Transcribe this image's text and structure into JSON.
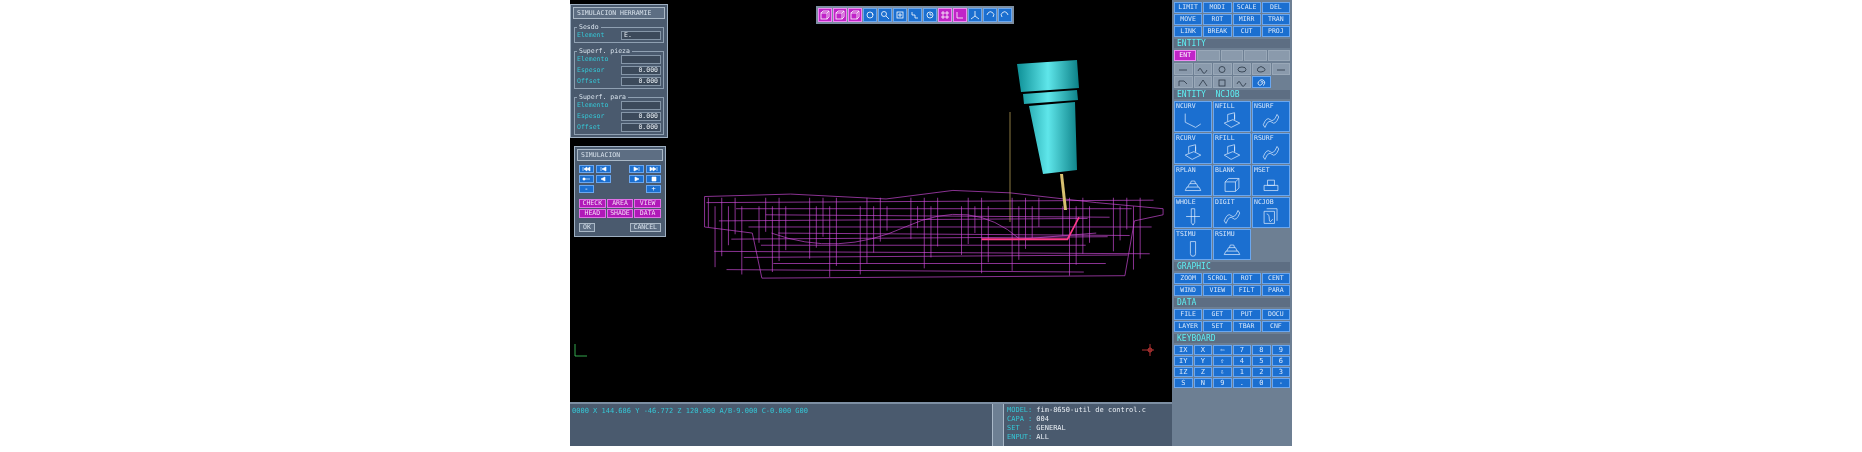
{
  "sim_dialog": {
    "title": "SIMULACION HERRAMIE",
    "groups": [
      {
        "title": "Sesdo",
        "fields": [
          {
            "label": "Element",
            "value": "E."
          }
        ]
      },
      {
        "title": "Superf. pieza",
        "fields": [
          {
            "label": "Elemento"
          },
          {
            "label": "Espesor",
            "value": "0.000"
          },
          {
            "label": "Offset",
            "value": "0.000"
          }
        ]
      },
      {
        "title": "Superf. para",
        "fields": [
          {
            "label": "Elemento"
          },
          {
            "label": "Espesor",
            "value": "0.000"
          },
          {
            "label": "Offset",
            "value": "0.000"
          }
        ]
      }
    ]
  },
  "sim_controls": {
    "title": "SIMULACION",
    "transport": [
      {
        "kind": "first"
      },
      {
        "kind": "step-back"
      },
      {
        "kind": "step-forward"
      },
      {
        "kind": "last"
      },
      {
        "kind": "key"
      },
      {
        "kind": "reverse"
      },
      {
        "kind": "play"
      },
      {
        "kind": "stop"
      }
    ],
    "minus": "-",
    "plus": "+",
    "modes": [
      "CHECK",
      "AREA",
      "VIEW",
      "HEAD",
      "SHADE",
      "DATA"
    ],
    "ok": "OK",
    "cancel": "CANCEL"
  },
  "toolbar": [
    {
      "kind": "cube",
      "active": true
    },
    {
      "kind": "cube",
      "active": true
    },
    {
      "kind": "cube",
      "active": true
    },
    {
      "kind": "rotate",
      "active": false
    },
    {
      "kind": "zoom",
      "active": false
    },
    {
      "kind": "fit",
      "active": false
    },
    {
      "kind": "pan",
      "active": false
    },
    {
      "kind": "refresh",
      "active": false
    },
    {
      "kind": "grid",
      "active": true
    },
    {
      "kind": "corner",
      "active": true
    },
    {
      "kind": "axes",
      "active": false
    },
    {
      "kind": "undo",
      "active": false
    },
    {
      "kind": "redo",
      "active": false
    }
  ],
  "right_panel": {
    "edit_buttons": [
      "LIMIT",
      "MODI",
      "SCALE",
      "DEL",
      "MOVE",
      "ROT",
      "MIRR",
      "TRAN",
      "LINK",
      "BREAK",
      "CUT",
      "PROJ"
    ],
    "entity": {
      "title": "ENTITY",
      "filters": [
        {
          "label": "ENT",
          "active": true
        },
        {
          "active": false
        },
        {
          "active": false
        },
        {
          "active": false
        },
        {
          "active": false
        }
      ],
      "icons": [
        {
          "kind": "line",
          "selected": false
        },
        {
          "kind": "wave",
          "selected": false
        },
        {
          "kind": "circle",
          "selected": false
        },
        {
          "kind": "ellipse",
          "selected": false
        },
        {
          "kind": "blob",
          "selected": false
        },
        {
          "kind": "line",
          "selected": false
        },
        {
          "kind": "poly",
          "selected": false
        },
        {
          "kind": "triangle",
          "selected": false
        },
        {
          "kind": "rect",
          "selected": false
        },
        {
          "kind": "wave",
          "selected": false
        },
        {
          "kind": "spiral",
          "selected": true
        }
      ]
    },
    "tiles_title": "ENTITY  NCJOB",
    "tiles": [
      {
        "label": "NCURV",
        "kind": "curve"
      },
      {
        "label": "NFILL",
        "kind": "fill"
      },
      {
        "label": "NSURF",
        "kind": "surface"
      },
      {
        "label": "RCURV",
        "kind": "fill"
      },
      {
        "label": "RFILL",
        "kind": "fill"
      },
      {
        "label": "RSURF",
        "kind": "surface"
      },
      {
        "label": "RPLAN",
        "kind": "plan"
      },
      {
        "label": "BLANK",
        "kind": "block"
      },
      {
        "label": "MSET",
        "kind": "set"
      },
      {
        "label": "WHOLE",
        "kind": "drill"
      },
      {
        "label": "DIGIT",
        "kind": "surface"
      },
      {
        "label": "NCJOB",
        "kind": "job"
      },
      {
        "label": "TSIMU",
        "kind": "tool"
      },
      {
        "label": "RSIMU",
        "kind": "plan"
      }
    ],
    "graphic": {
      "title": "GRAPHIC",
      "buttons": [
        "ZOOM",
        "SCROL",
        "ROT",
        "CENT",
        "WIND",
        "VIEW",
        "FILT",
        "PARA"
      ]
    },
    "data": {
      "title": "DATA",
      "buttons": [
        "FILE",
        "GET",
        "PUT",
        "DOCU",
        "LAYER",
        "SET",
        "TBAR",
        "CNF"
      ]
    },
    "keyboard": {
      "title": "KEYBOARD",
      "keys": [
        "IX",
        "X",
        "⇦",
        "7",
        "8",
        "9",
        "IY",
        "Y",
        "⇧",
        "4",
        "5",
        "6",
        "IZ",
        "Z",
        "⇩",
        "1",
        "2",
        "3",
        "S",
        "N",
        "9",
        ".",
        "0",
        "-"
      ]
    }
  },
  "status_bar": {
    "coordinates": "0000 X 144.686 Y -46.772 Z 120.000 A/B-9.000 C-0.000 G00",
    "info": [
      {
        "label": "MODEL:",
        "value": "fim-8650-util de control.c"
      },
      {
        "label": "CAPA :",
        "value": "004"
      },
      {
        "label": "SET  :",
        "value": "GENERAL"
      },
      {
        "label": "ENPUT:",
        "value": "ALL"
      }
    ]
  }
}
